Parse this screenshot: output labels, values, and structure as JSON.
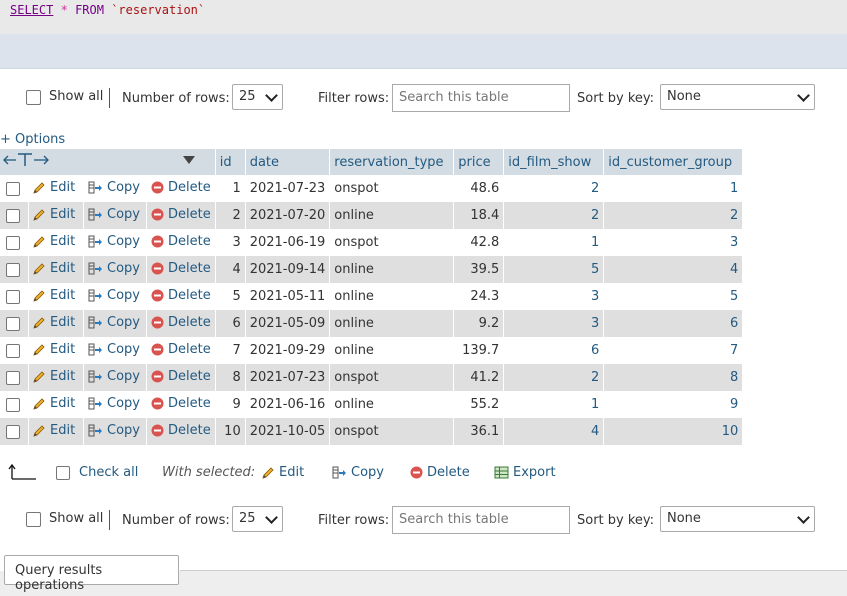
{
  "sql": {
    "select": "SELECT",
    "star": "*",
    "from": "FROM",
    "table": "`reservation`"
  },
  "top_nav": {
    "show_all": "Show all",
    "number_of_rows_label": "Number of rows:",
    "rows_value": "25",
    "filter_label": "Filter rows:",
    "filter_placeholder": "Search this table",
    "sort_label": "Sort by key:",
    "sort_value": "None"
  },
  "options_link": "+ Options",
  "table": {
    "columns": [
      "id",
      "date",
      "reservation_type",
      "price",
      "id_film_show",
      "id_customer_group"
    ],
    "action_labels": {
      "edit": "Edit",
      "copy": "Copy",
      "delete": "Delete"
    },
    "rows": [
      {
        "id": "1",
        "date": "2021-07-23",
        "type": "onspot",
        "price": "48.6",
        "film": "2",
        "group": "1"
      },
      {
        "id": "2",
        "date": "2021-07-20",
        "type": "online",
        "price": "18.4",
        "film": "2",
        "group": "2"
      },
      {
        "id": "3",
        "date": "2021-06-19",
        "type": "onspot",
        "price": "42.8",
        "film": "1",
        "group": "3"
      },
      {
        "id": "4",
        "date": "2021-09-14",
        "type": "online",
        "price": "39.5",
        "film": "5",
        "group": "4"
      },
      {
        "id": "5",
        "date": "2021-05-11",
        "type": "online",
        "price": "24.3",
        "film": "3",
        "group": "5"
      },
      {
        "id": "6",
        "date": "2021-05-09",
        "type": "online",
        "price": "9.2",
        "film": "3",
        "group": "6"
      },
      {
        "id": "7",
        "date": "2021-09-29",
        "type": "online",
        "price": "139.7",
        "film": "6",
        "group": "7"
      },
      {
        "id": "8",
        "date": "2021-07-23",
        "type": "onspot",
        "price": "41.2",
        "film": "2",
        "group": "8"
      },
      {
        "id": "9",
        "date": "2021-06-16",
        "type": "online",
        "price": "55.2",
        "film": "1",
        "group": "9"
      },
      {
        "id": "10",
        "date": "2021-10-05",
        "type": "onspot",
        "price": "36.1",
        "film": "4",
        "group": "10"
      }
    ]
  },
  "bulk": {
    "check_all": "Check all",
    "with_selected": "With selected:",
    "edit": "Edit",
    "copy": "Copy",
    "delete": "Delete",
    "export": "Export"
  },
  "bottom_nav": {
    "show_all": "Show all",
    "number_of_rows_label": "Number of rows:",
    "rows_value": "25",
    "filter_label": "Filter rows:",
    "filter_placeholder": "Search this table",
    "sort_label": "Sort by key:",
    "sort_value": "None"
  },
  "query_results_operations": "Query results operations"
}
